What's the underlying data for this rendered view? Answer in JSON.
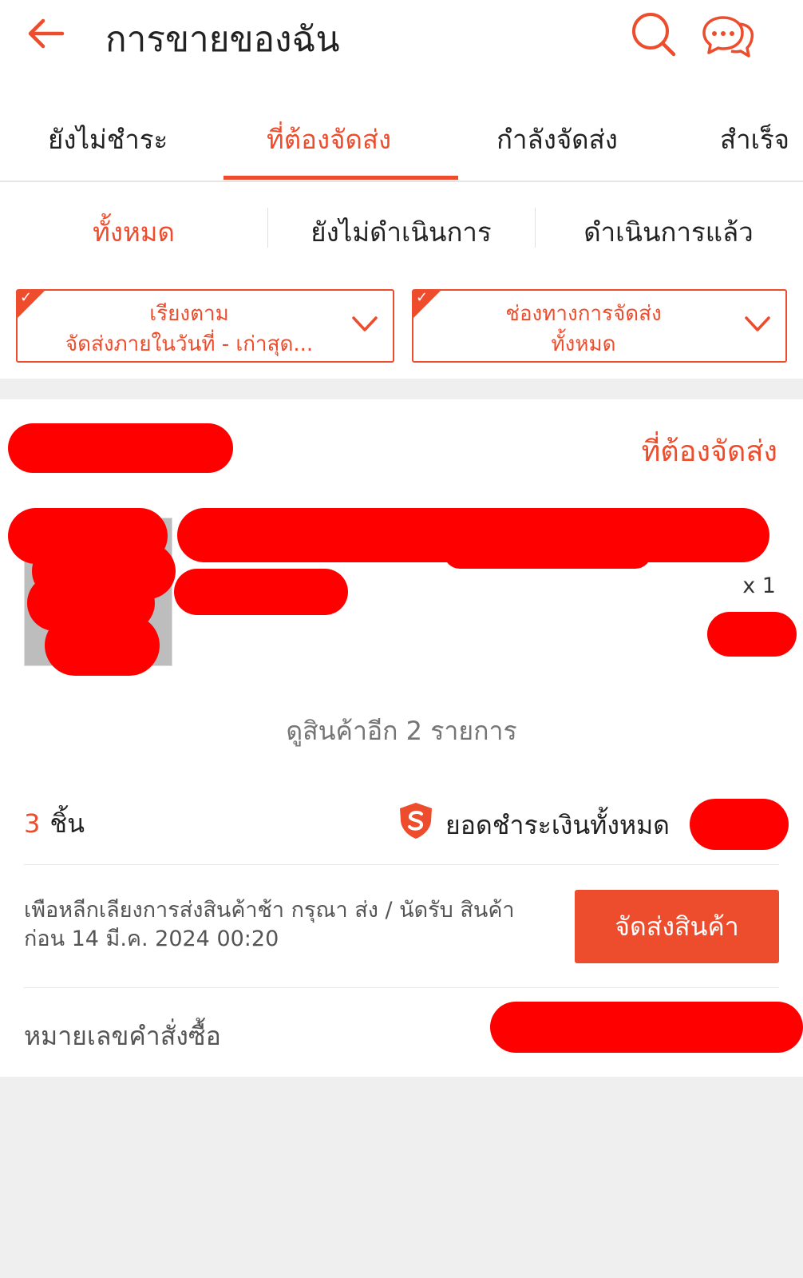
{
  "header": {
    "title": "การขายของฉัน",
    "back_icon": "arrow-left-icon",
    "search_icon": "search-icon",
    "chat_icon": "chat-bubbles-icon",
    "accent_color": "#ee4d2d"
  },
  "tabs": [
    {
      "label": "ยังไม่ชำระ",
      "active": false
    },
    {
      "label": "ที่ต้องจัดส่ง",
      "active": true
    },
    {
      "label": "กำลังจัดส่ง",
      "active": false
    },
    {
      "label": "สำเร็จ",
      "active": false
    }
  ],
  "subtabs": [
    {
      "label": "ทั้งหมด",
      "active": true
    },
    {
      "label": "ยังไม่ดำเนินการ",
      "active": false
    },
    {
      "label": "ดำเนินการแล้ว",
      "active": false
    }
  ],
  "filters": [
    {
      "line1": "เรียงตาม",
      "line2": "จัดส่งภายในวันที่ - เก่าสุด..."
    },
    {
      "line1": "ช่องทางการจัดส่ง",
      "line2": "ทั้งหมด"
    }
  ],
  "order": {
    "status": "ที่ต้องจัดส่ง",
    "quantity": "x 1",
    "more_items": "ดูสินค้าอีก 2 รายการ",
    "item_count": "3",
    "item_unit": "ชิ้น",
    "total_label": "ยอดชำระเงินทั้งหมด",
    "notice": "เพือหลีกเลียงการส่งสินค้าช้า กรุณา ส่ง / นัดรับ สินค้า ก่อน 14 มี.ค. 2024 00:20",
    "ship_button": "จัดส่งสินค้า",
    "order_number_label": "หมายเลขคำสั่งซื้อ"
  }
}
